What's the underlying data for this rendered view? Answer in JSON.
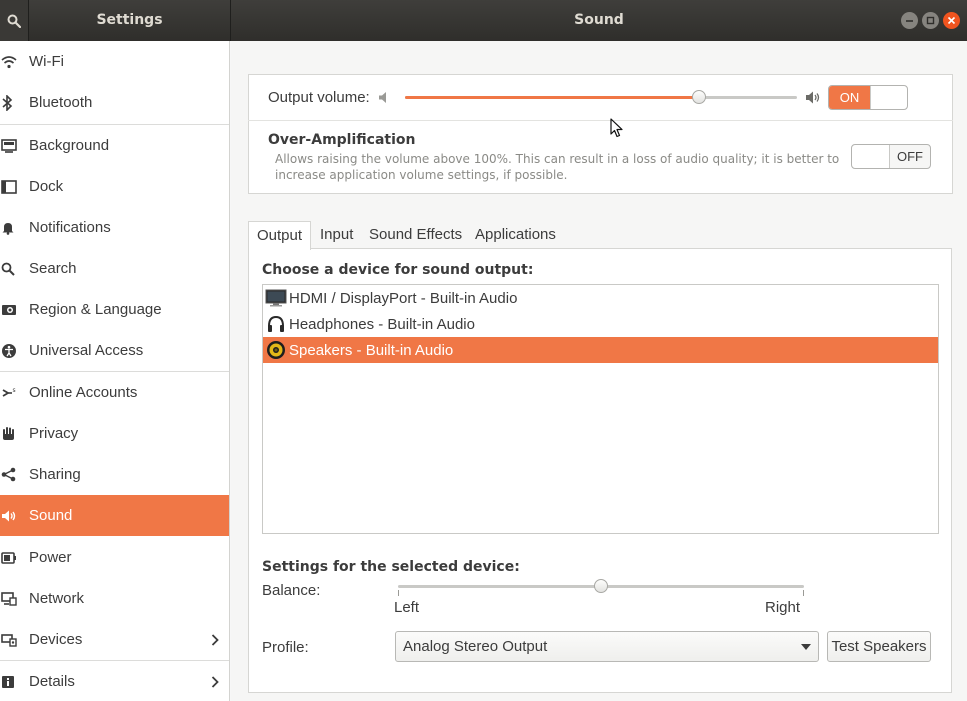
{
  "window": {
    "sidebar_title": "Settings",
    "main_title": "Sound"
  },
  "sidebar": {
    "items": [
      {
        "label": "Wi-Fi",
        "icon": "wifi-icon"
      },
      {
        "label": "Bluetooth",
        "icon": "bluetooth-icon"
      },
      {
        "label": "Background",
        "icon": "background-icon"
      },
      {
        "label": "Dock",
        "icon": "dock-icon"
      },
      {
        "label": "Notifications",
        "icon": "bell-icon"
      },
      {
        "label": "Search",
        "icon": "search-icon"
      },
      {
        "label": "Region & Language",
        "icon": "camera-icon"
      },
      {
        "label": "Universal Access",
        "icon": "accessibility-icon"
      },
      {
        "label": "Online Accounts",
        "icon": "online-accounts-icon"
      },
      {
        "label": "Privacy",
        "icon": "hand-icon"
      },
      {
        "label": "Sharing",
        "icon": "share-icon"
      },
      {
        "label": "Sound",
        "icon": "speaker-icon",
        "active": true
      },
      {
        "label": "Power",
        "icon": "battery-icon"
      },
      {
        "label": "Network",
        "icon": "network-icon"
      },
      {
        "label": "Devices",
        "icon": "devices-icon",
        "has_submenu": true
      },
      {
        "label": "Details",
        "icon": "info-icon",
        "has_submenu": true
      }
    ]
  },
  "volume": {
    "label": "Output volume:",
    "level": 0.75,
    "switch_label": "ON",
    "switch_state": true
  },
  "amplification": {
    "title": "Over-Amplification",
    "description": "Allows raising the volume above 100%. This can result in a loss of audio quality; it is better to increase application volume settings, if possible.",
    "switch_label": "OFF",
    "switch_state": false
  },
  "tabs": [
    {
      "label": "Output",
      "active": true
    },
    {
      "label": "Input"
    },
    {
      "label": "Sound Effects"
    },
    {
      "label": "Applications"
    }
  ],
  "output": {
    "choose_label": "Choose a device for sound output:",
    "devices": [
      {
        "label": "HDMI / DisplayPort - Built-in Audio",
        "icon": "monitor-icon"
      },
      {
        "label": "Headphones - Built-in Audio",
        "icon": "headphones-icon"
      },
      {
        "label": "Speakers - Built-in Audio",
        "icon": "speaker-device-icon",
        "selected": true
      }
    ],
    "settings_label": "Settings for the selected device:",
    "balance_label": "Balance:",
    "balance_left": "Left",
    "balance_right": "Right",
    "balance_value": 0.5,
    "profile_label": "Profile:",
    "profile_value": "Analog Stereo Output",
    "test_button": "Test Speakers"
  },
  "colors": {
    "accent": "#f07746",
    "headerbar": "#3a3936"
  }
}
